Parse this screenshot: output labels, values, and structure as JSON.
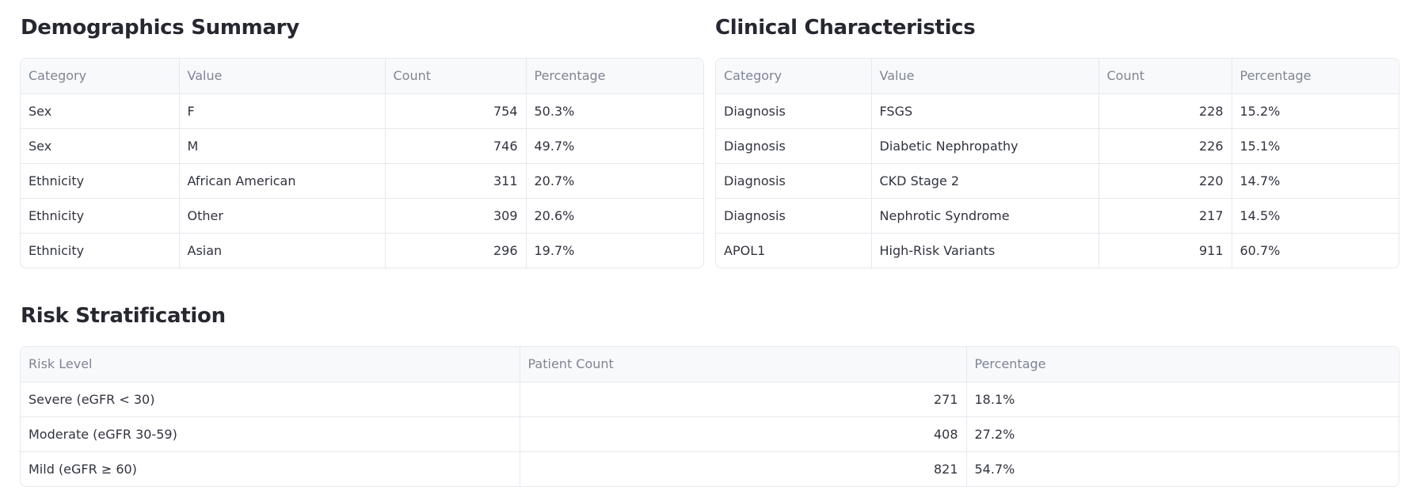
{
  "demographics": {
    "title": "Demographics Summary",
    "headers": [
      "Category",
      "Value",
      "Count",
      "Percentage"
    ],
    "rows": [
      [
        "Sex",
        "F",
        "754",
        "50.3%"
      ],
      [
        "Sex",
        "M",
        "746",
        "49.7%"
      ],
      [
        "Ethnicity",
        "African American",
        "311",
        "20.7%"
      ],
      [
        "Ethnicity",
        "Other",
        "309",
        "20.6%"
      ],
      [
        "Ethnicity",
        "Asian",
        "296",
        "19.7%"
      ]
    ]
  },
  "clinical": {
    "title": "Clinical Characteristics",
    "headers": [
      "Category",
      "Value",
      "Count",
      "Percentage"
    ],
    "rows": [
      [
        "Diagnosis",
        "FSGS",
        "228",
        "15.2%"
      ],
      [
        "Diagnosis",
        "Diabetic Nephropathy",
        "226",
        "15.1%"
      ],
      [
        "Diagnosis",
        "CKD Stage 2",
        "220",
        "14.7%"
      ],
      [
        "Diagnosis",
        "Nephrotic Syndrome",
        "217",
        "14.5%"
      ],
      [
        "APOL1",
        "High-Risk Variants",
        "911",
        "60.7%"
      ]
    ]
  },
  "risk": {
    "title": "Risk Stratification",
    "headers": [
      "Risk Level",
      "Patient Count",
      "Percentage"
    ],
    "rows": [
      [
        "Severe (eGFR < 30)",
        "271",
        "18.1%"
      ],
      [
        "Moderate (eGFR 30-59)",
        "408",
        "27.2%"
      ],
      [
        "Mild (eGFR ≥ 60)",
        "821",
        "54.7%"
      ]
    ]
  }
}
